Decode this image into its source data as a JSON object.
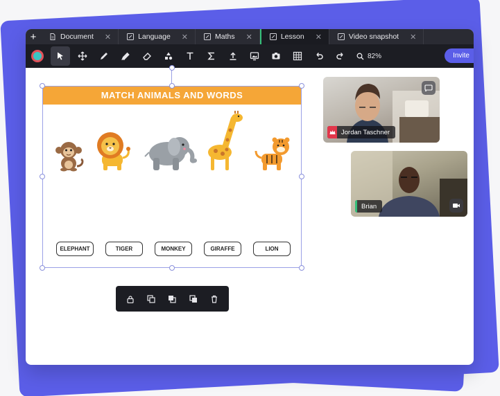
{
  "tabs": [
    {
      "label": "Document",
      "icon": "document-icon"
    },
    {
      "label": "Language",
      "icon": "edit-icon"
    },
    {
      "label": "Maths",
      "icon": "edit-icon"
    },
    {
      "label": "Lesson",
      "icon": "edit-icon"
    },
    {
      "label": "Video snapshot",
      "icon": "edit-icon"
    }
  ],
  "active_tab": "Lesson",
  "toolbar": {
    "active_color": "#3bc4c4",
    "zoom": "82%",
    "invite_label": "Invite"
  },
  "lesson": {
    "title": "MATCH ANIMALS AND WORDS",
    "animals": [
      "monkey",
      "lion",
      "elephant",
      "giraffe",
      "tiger"
    ],
    "words": [
      "ELEPHANT",
      "TIGER",
      "MONKEY",
      "GIRAFFE",
      "LION"
    ]
  },
  "participants": [
    {
      "name": "Jordan Taschner",
      "role": "host"
    },
    {
      "name": "Brian",
      "role": "participant"
    }
  ],
  "colors": {
    "accent": "#5b5ee8",
    "title_bar": "#f5a637",
    "host_badge": "#e2374b",
    "speaking": "#36c07a"
  }
}
